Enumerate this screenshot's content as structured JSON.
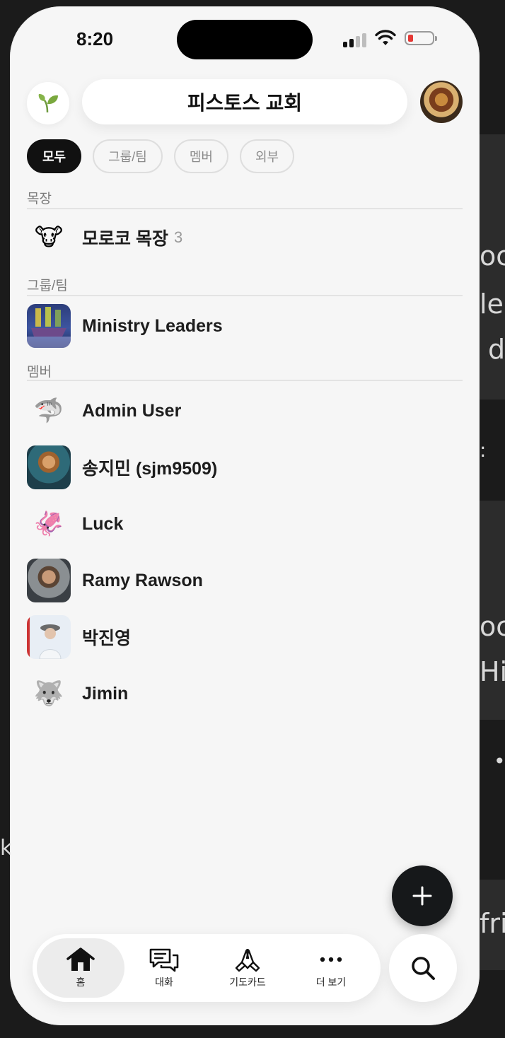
{
  "status_bar": {
    "time": "8:20"
  },
  "header": {
    "title": "피스토스 교회",
    "leaf_icon": "seedling-icon",
    "profile_icon": "burger-avatar"
  },
  "filters": [
    {
      "label": "모두",
      "active": true
    },
    {
      "label": "그룹/팀",
      "active": false
    },
    {
      "label": "멤버",
      "active": false
    },
    {
      "label": "외부",
      "active": false
    }
  ],
  "sections": {
    "mokjang": {
      "label": "목장",
      "items": [
        {
          "name": "모로코 목장",
          "count": "3",
          "avatar": "🐮"
        }
      ]
    },
    "groups": {
      "label": "그룹/팀",
      "items": [
        {
          "name": "Ministry Leaders",
          "avatar": "ship-image"
        }
      ]
    },
    "members": {
      "label": "멤버",
      "items": [
        {
          "name": "Admin User",
          "avatar": "🦈"
        },
        {
          "name": "송지민 (sjm9509)",
          "avatar": "painting-portrait"
        },
        {
          "name": "Luck",
          "avatar": "🦑"
        },
        {
          "name": "Ramy Rawson",
          "avatar": "astronaut-portrait"
        },
        {
          "name": "박진영",
          "avatar": "hat-photo"
        },
        {
          "name": "Jimin",
          "avatar": "🐺"
        }
      ]
    }
  },
  "tabs": [
    {
      "label": "홈",
      "icon": "home-icon",
      "active": true
    },
    {
      "label": "대화",
      "icon": "chat-icon",
      "active": false
    },
    {
      "label": "기도카드",
      "icon": "praying-hands-icon",
      "active": false
    },
    {
      "label": "더 보기",
      "icon": "more-icon",
      "active": false
    }
  ],
  "fab": {
    "icon": "plus-icon"
  },
  "search": {
    "icon": "search-icon"
  },
  "background": {
    "snippets": [
      "oc",
      "le",
      "d",
      ":",
      "oc",
      "Hi",
      "•",
      "k",
      "fri"
    ]
  }
}
